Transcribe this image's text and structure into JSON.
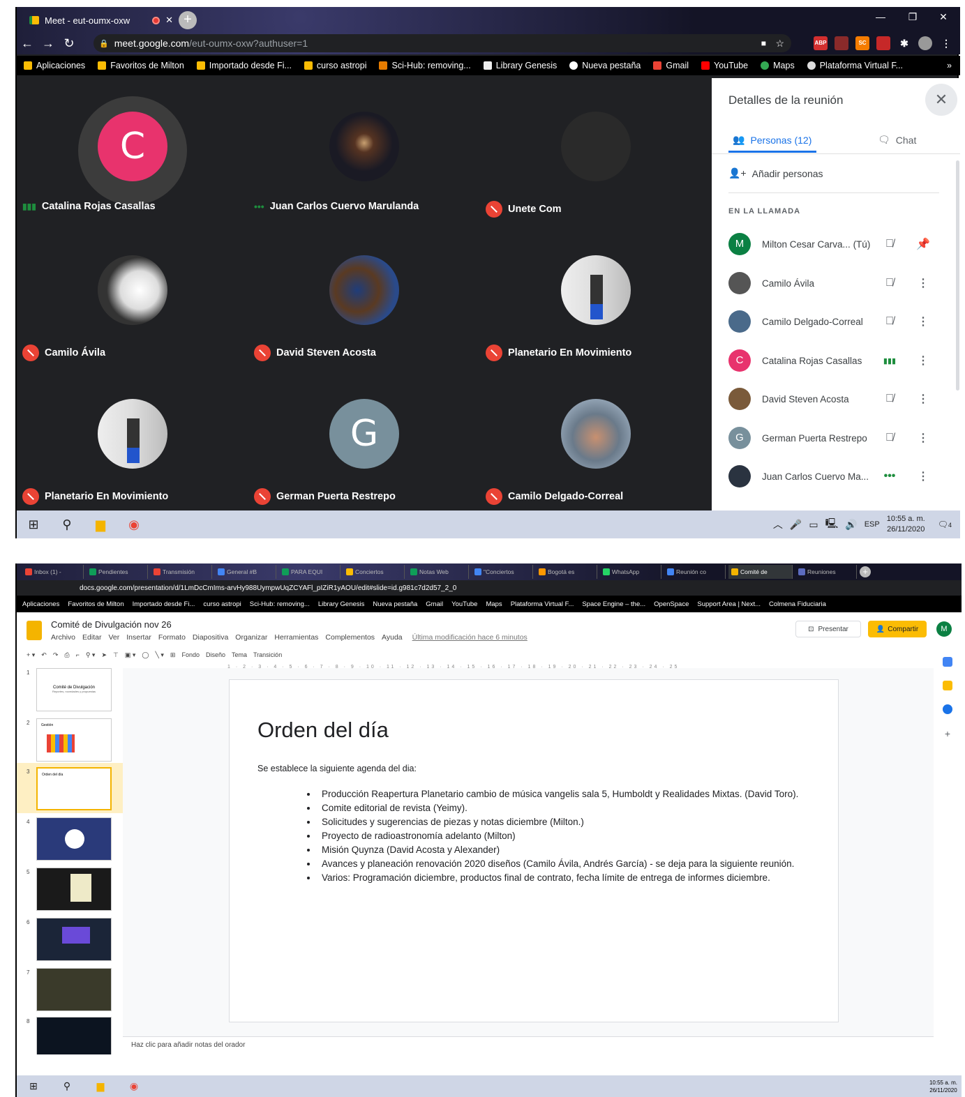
{
  "top_window": {
    "tab_title": "Meet - eut-oumx-oxw",
    "url_main": "meet.google.com",
    "url_rest": "/eut-oumx-oxw?authuser=1",
    "bookmarks": [
      "Aplicaciones",
      "Favoritos de Milton",
      "Importado desde Fi...",
      "curso astropi",
      "Sci-Hub: removing...",
      "Library Genesis",
      "Nueva pestaña",
      "Gmail",
      "YouTube",
      "Maps",
      "Plataforma Virtual F..."
    ],
    "bookmark_more": "»"
  },
  "grid": {
    "tiles": [
      {
        "name": "Catalina Rojas Casallas",
        "letter": "C",
        "status": "speaking"
      },
      {
        "name": "Juan Carlos Cuervo Marulanda",
        "letter": "",
        "status": "dots"
      },
      {
        "name": "Unete Com",
        "letter": "",
        "status": "muted"
      },
      {
        "name": "Camilo Ávila",
        "letter": "",
        "status": "muted"
      },
      {
        "name": "David Steven Acosta",
        "letter": "",
        "status": "muted"
      },
      {
        "name": "Planetario En Movimiento",
        "letter": "",
        "status": "muted"
      },
      {
        "name": "Planetario En Movimiento",
        "letter": "",
        "status": "muted"
      },
      {
        "name": "German Puerta Restrepo",
        "letter": "G",
        "status": "muted"
      },
      {
        "name": "Camilo Delgado-Correal",
        "letter": "",
        "status": "muted"
      }
    ]
  },
  "panel": {
    "title": "Detalles de la reunión",
    "close": "✕",
    "tab_people": "Personas (12)",
    "tab_chat": "Chat",
    "add_people": "Añadir personas",
    "section": "EN LA LLAMADA",
    "participants": [
      {
        "name": "Milton Cesar Carva...",
        "suffix": "(Tú)",
        "initial": "M",
        "color": "#0b8043"
      },
      {
        "name": "Camilo Ávila",
        "suffix": "",
        "initial": "",
        "color": "#555555"
      },
      {
        "name": "Camilo Delgado-Correal",
        "suffix": "",
        "initial": "",
        "color": "#4a6a8a"
      },
      {
        "name": "Catalina Rojas Casallas",
        "suffix": "",
        "initial": "C",
        "color": "#e8336d"
      },
      {
        "name": "David Steven Acosta",
        "suffix": "",
        "initial": "",
        "color": "#7a5a3a"
      },
      {
        "name": "German Puerta Restrepo",
        "suffix": "",
        "initial": "G",
        "color": "#78909c"
      },
      {
        "name": "Juan Carlos Cuervo Ma...",
        "suffix": "",
        "initial": "",
        "color": "#2a3340"
      }
    ]
  },
  "taskbar1": {
    "lang": "ESP",
    "time": "10:55 a. m.",
    "date": "26/11/2020",
    "notif": "4"
  },
  "bottom_window": {
    "tabs": [
      "Inbox (1) -",
      "Pendientes",
      "Transmisión",
      "General #B",
      "PARA EQUI",
      "Conciertos",
      "Notas Web",
      "\"Conciertos",
      "Bogotá es",
      "WhatsApp",
      "Reunión co",
      "Comité de",
      "Reuniones"
    ],
    "url": "docs.google.com/presentation/d/1LmDcCmIms-arvHy988UympwUqZCYAFl_pIZiR1yAOU/edit#slide=id.g981c7d2d57_2_0",
    "bookmarks": [
      "Aplicaciones",
      "Favoritos de Milton",
      "Importado desde Fi...",
      "curso astropi",
      "Sci-Hub: removing...",
      "Library Genesis",
      "Nueva pestaña",
      "Gmail",
      "YouTube",
      "Maps",
      "Plataforma Virtual F...",
      "Space Engine – the...",
      "OpenSpace",
      "Support Area | Next...",
      "Colmena Fiduciaria"
    ]
  },
  "slides": {
    "doc_title": "Comité de Divulgación nov 26",
    "menu": [
      "Archivo",
      "Editar",
      "Ver",
      "Insertar",
      "Formato",
      "Diapositiva",
      "Organizar",
      "Herramientas",
      "Complementos",
      "Ayuda"
    ],
    "last_edit": "Última modificación hace 6 minutos",
    "present": "Presentar",
    "share": "Compartir",
    "user_initial": "M",
    "toolbar": [
      "Fondo",
      "Diseño",
      "Tema",
      "Transición"
    ],
    "ruler": "1 · 2 · 3 · 4 · 5 · 6 · 7 · 8 · 9 · 10 · 11 · 12 · 13 · 14 · 15 · 16 · 17 · 18 · 19 · 20 · 21 · 22 · 23 · 24 · 25",
    "slide_title": "Orden del día",
    "slide_intro": "Se establece la siguiente agenda del dia:",
    "bullets": [
      "Producción Reapertura Planetario cambio de música vangelis sala 5, Humboldt y Realidades Mixtas. (David Toro).",
      "Comite editorial de revista (Yeimy).",
      "Solicitudes y sugerencias de piezas y notas diciembre (Milton.)",
      "Proyecto de radioastronomía adelanto (Milton)",
      "Misión Quynza (David Acosta y Alexander)",
      "Avances y planeación renovación 2020 diseños (Camilo Ávila, Andrés García) - se deja para la siguiente reunión.",
      "Varios: Programación diciembre, productos final de contrato, fecha límite de entrega de informes diciembre."
    ],
    "thumb1_title": "Comité de Divulgación",
    "thumb1_sub": "Reportes, novedades y propuestas",
    "thumb2_title": "Gestión",
    "thumb3_title": "Orden del día",
    "notes": "Haz clic para añadir notas del orador",
    "slide_numbers": [
      "1",
      "2",
      "3",
      "4",
      "5",
      "6",
      "7",
      "8"
    ]
  },
  "taskbar2": {
    "time": "10:55 a. m.",
    "date": "26/11/2020"
  }
}
